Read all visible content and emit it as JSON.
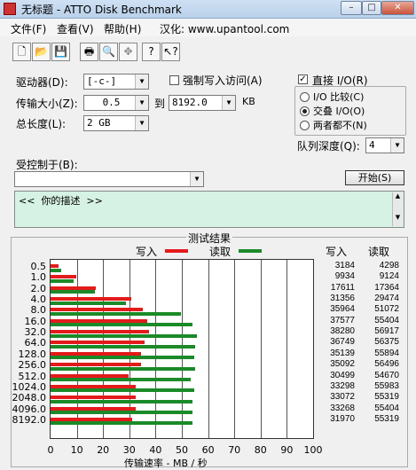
{
  "window": {
    "title": "无标题 - ATTO Disk Benchmark",
    "minimize": "–",
    "maximize": "□",
    "close": "✕"
  },
  "menu": [
    "文件(F)",
    "查看(V)",
    "帮助(H)",
    "汉化: www.upantool.com"
  ],
  "toolbar_icons": [
    "new-file-icon",
    "open-folder-icon",
    "save-icon",
    "print-icon",
    "print-preview-icon",
    "move-icon",
    "help-icon",
    "context-help-icon"
  ],
  "form": {
    "drive_label": "驱动器(D):",
    "drive_value": "[-c-]",
    "force_write_label": "强制写入访问(A)",
    "force_write_checked": false,
    "transfer_label": "传输大小(Z):",
    "transfer_from": "0.5",
    "to_label": "到",
    "transfer_to": "8192.0",
    "kb_label": "KB",
    "total_label": "总长度(L):",
    "total_value": "2 GB",
    "direct_io_label": "直接 I/O(R)",
    "direct_io_checked": true,
    "radio_compare": "I/O 比较(C)",
    "radio_overlap": "交叠 I/O(O)",
    "radio_neither": "两者都不(N)",
    "selected_radio": "overlap",
    "queue_label": "队列深度(Q):",
    "queue_value": "4",
    "controlled_label": "受控制于(B):",
    "controlled_value": "",
    "start_button": "开始(S)",
    "description": "<<  你的描述  >>"
  },
  "results": {
    "frame_title": "测试结果",
    "legend_write": "写入",
    "legend_read": "读取",
    "col_write": "写入",
    "col_read": "读取",
    "xlabel": "传输速率 - MB / 秒",
    "write_color": "#e31b1b",
    "read_color": "#1b8a28"
  },
  "chart_data": {
    "type": "bar",
    "orientation": "horizontal",
    "xlabel": "传输速率 - MB / 秒",
    "xlim": [
      0,
      100
    ],
    "xticks": [
      0,
      10,
      20,
      30,
      40,
      50,
      60,
      70,
      80,
      90,
      100
    ],
    "grid": true,
    "categories": [
      "0.5",
      "1.0",
      "2.0",
      "4.0",
      "8.0",
      "16.0",
      "32.0",
      "64.0",
      "128.0",
      "256.0",
      "512.0",
      "1024.0",
      "2048.0",
      "4096.0",
      "8192.0"
    ],
    "series": [
      {
        "name": "写入",
        "mbps": [
          3.1,
          9.7,
          17.2,
          30.6,
          35.1,
          36.7,
          37.4,
          35.9,
          34.3,
          34.3,
          29.8,
          32.5,
          32.3,
          32.5,
          31.2
        ],
        "labels": [
          "3184",
          "9934",
          "17611",
          "31356",
          "35964",
          "37577",
          "38280",
          "36749",
          "35139",
          "35092",
          "30499",
          "33298",
          "33072",
          "33268",
          "31970"
        ]
      },
      {
        "name": "读取",
        "mbps": [
          4.2,
          8.9,
          17.0,
          28.8,
          49.8,
          54.1,
          55.6,
          55.1,
          54.6,
          55.2,
          53.4,
          54.7,
          54.0,
          54.1,
          54.0
        ],
        "labels": [
          "4298",
          "9124",
          "17364",
          "29474",
          "51072",
          "55404",
          "56917",
          "56375",
          "55894",
          "56496",
          "54670",
          "55983",
          "55319",
          "55404",
          "55319"
        ]
      }
    ]
  }
}
